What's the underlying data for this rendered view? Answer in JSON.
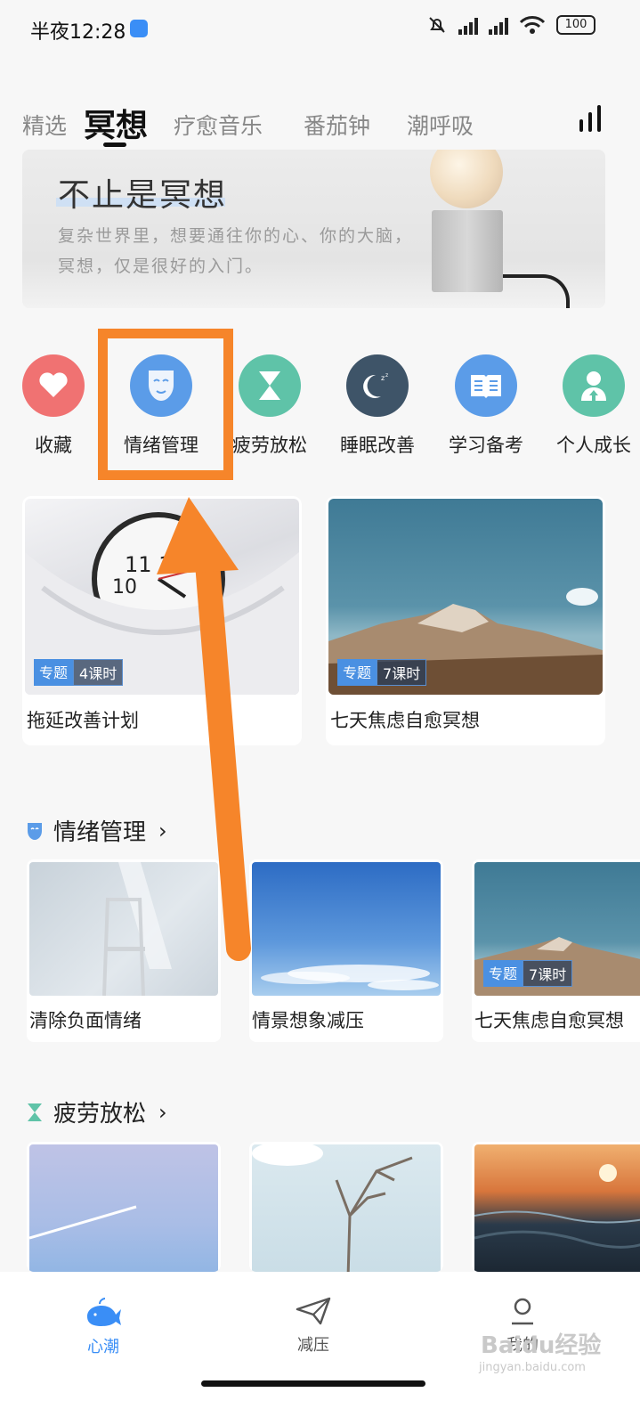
{
  "status_bar": {
    "time": "半夜12:28",
    "battery": "100",
    "icons": [
      "mute-bell-icon",
      "hd-signal-icon",
      "hd-signal-icon",
      "wifi-icon",
      "battery-icon"
    ]
  },
  "tabs": {
    "items": [
      "精选",
      "冥想",
      "疗愈音乐",
      "番茄钟",
      "潮呼吸"
    ],
    "active": "冥想"
  },
  "banner": {
    "title": "不止是冥想",
    "subtitle": "复杂世界里，想要通往你的心、你的大脑，冥想，仅是很好的入门。"
  },
  "categories": [
    {
      "label": "收藏",
      "icon": "heart-icon",
      "color": "#f07272"
    },
    {
      "label": "情绪管理",
      "icon": "mask-icon",
      "color": "#5b9ce8"
    },
    {
      "label": "疲劳放松",
      "icon": "hourglass-icon",
      "color": "#5fc3a8"
    },
    {
      "label": "睡眠改善",
      "icon": "moon-icon",
      "color": "#3e5468"
    },
    {
      "label": "学习备考",
      "icon": "book-icon",
      "color": "#5b9ce8"
    },
    {
      "label": "个人成长",
      "icon": "person-icon",
      "color": "#5fc3a8"
    }
  ],
  "topics": [
    {
      "title": "拖延改善计划",
      "badge_type": "专题",
      "badge_count": "4课时"
    },
    {
      "title": "七天焦虑自愈冥想",
      "badge_type": "专题",
      "badge_count": "7课时"
    }
  ],
  "sections": [
    {
      "title": "情绪管理",
      "icon": "mask-icon",
      "items": [
        {
          "title": "清除负面情绪"
        },
        {
          "title": "情景想象减压"
        },
        {
          "title": "七天焦虑自愈冥想",
          "badge_type": "专题",
          "badge_count": "7课时"
        }
      ]
    },
    {
      "title": "疲劳放松",
      "icon": "hourglass-icon",
      "items": [
        {
          "title": ""
        },
        {
          "title": ""
        },
        {
          "title": ""
        }
      ]
    }
  ],
  "bottom_nav": [
    {
      "label": "心潮",
      "icon": "whale-icon",
      "active": true
    },
    {
      "label": "减压",
      "icon": "paper-plane-icon",
      "active": false
    },
    {
      "label": "我的",
      "icon": "user-icon",
      "active": false
    }
  ],
  "watermark": {
    "text": "Baidu经验",
    "sub": "jingyan.baidu.com"
  },
  "colors": {
    "accent": "#3a8ef6",
    "annotation": "#f6852a"
  }
}
